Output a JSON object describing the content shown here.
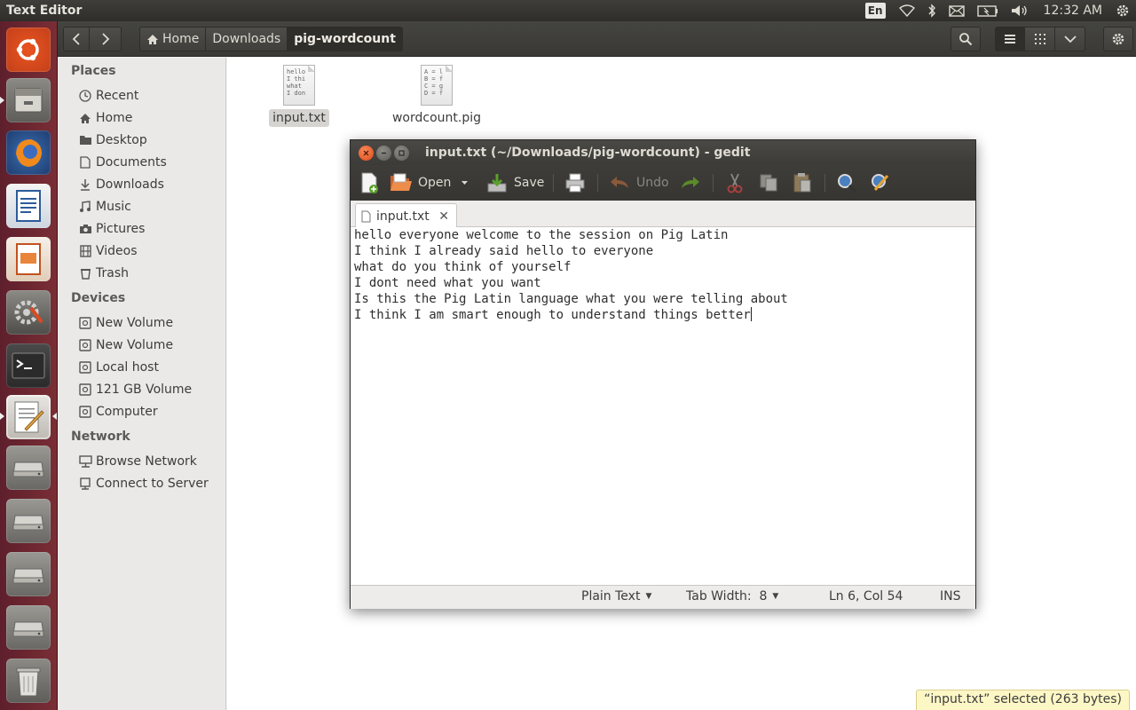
{
  "top_panel": {
    "app_title": "Text Editor",
    "keyboard_layout": "En",
    "clock": "12:32 AM",
    "icons": [
      "wifi-icon",
      "bluetooth-icon",
      "mail-icon",
      "battery-icon",
      "volume-icon",
      "settings-gear-icon"
    ]
  },
  "launcher": {
    "items": [
      "dash-home",
      "files",
      "firefox",
      "libreoffice-writer",
      "libreoffice-impress",
      "system-settings",
      "terminal",
      "text-editor",
      "drive",
      "drive",
      "drive",
      "drive",
      "trash"
    ]
  },
  "nautilus": {
    "breadcrumbs": [
      "Home",
      "Downloads",
      "pig-wordcount"
    ],
    "sidebar": {
      "places_heading": "Places",
      "places": [
        "Recent",
        "Home",
        "Desktop",
        "Documents",
        "Downloads",
        "Music",
        "Pictures",
        "Videos",
        "Trash"
      ],
      "devices_heading": "Devices",
      "devices": [
        "New Volume",
        "New Volume",
        "Local host",
        "121 GB Volume",
        "Computer"
      ],
      "network_heading": "Network",
      "network": [
        "Browse Network",
        "Connect to Server"
      ]
    },
    "files": [
      {
        "name": "input.txt",
        "preview": "hello\nI thi\nwhat\nI don"
      },
      {
        "name": "wordcount.pig",
        "preview": "A = l\nB = f\nC = g\nD = f"
      }
    ],
    "status": "“input.txt” selected  (263 bytes)"
  },
  "gedit": {
    "title": "input.txt (~/Downloads/pig-wordcount) - gedit",
    "toolbar": {
      "open": "Open",
      "save": "Save",
      "undo": "Undo"
    },
    "tab_label": "input.txt",
    "lines": [
      "hello everyone welcome to the session on Pig Latin",
      "I think I already said hello to everyone",
      "what do you think of yourself",
      "I dont need what you want",
      "Is this the Pig Latin language what you were telling about",
      "I think I am smart enough to understand things better"
    ],
    "status": {
      "language": "Plain Text",
      "tab_width": "Tab Width:  8",
      "position": "Ln 6, Col 54",
      "mode": "INS"
    }
  }
}
